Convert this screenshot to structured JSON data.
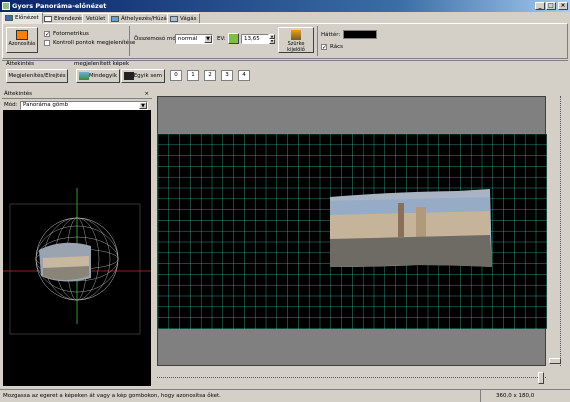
{
  "window": {
    "title": "Gyors Panoráma-előnézet"
  },
  "tabs": [
    {
      "label": "Előnézet"
    },
    {
      "label": "Elrendezés"
    },
    {
      "label": "Vetület"
    },
    {
      "label": "Áthelyezés/Húzás"
    },
    {
      "label": "Vágás"
    }
  ],
  "toolbar": {
    "identify_label": "Azonosítás",
    "photometric_label": "Fotometrikus",
    "control_points_label": "Kontroll pontok megjelenítése",
    "blend_mode_label": "Összemosó mód:",
    "blend_mode_value": "normál",
    "ev_label": "EV:",
    "ev_value": "13,65",
    "grey_point_label": "Szürke kijelölő",
    "background_label": "Háttér:",
    "grid_label": "Rács",
    "background_color": "#000000"
  },
  "row2": {
    "overview_group": "Áttekintés",
    "overview_button": "Megjelenítés/Elrejtés",
    "shown_images_group": "megjelenített képek",
    "all_button": "Mindegyik",
    "none_button": "Egyik sem",
    "image_numbers": [
      "0",
      "1",
      "2",
      "3",
      "4"
    ]
  },
  "left_panel": {
    "title": "Áttekintés",
    "mode_label": "Mód:",
    "mode_value": "Panoráma gömb"
  },
  "status": {
    "message": "Mozgassa az egeret a képeken át vagy a kép gombokon, hogy azonosítsa őket.",
    "projection_size": "360,0 x 180,0"
  },
  "colors": {
    "title_start": "#0a246a",
    "grid_line": "#3fbfaa",
    "view_background": "#000000"
  }
}
